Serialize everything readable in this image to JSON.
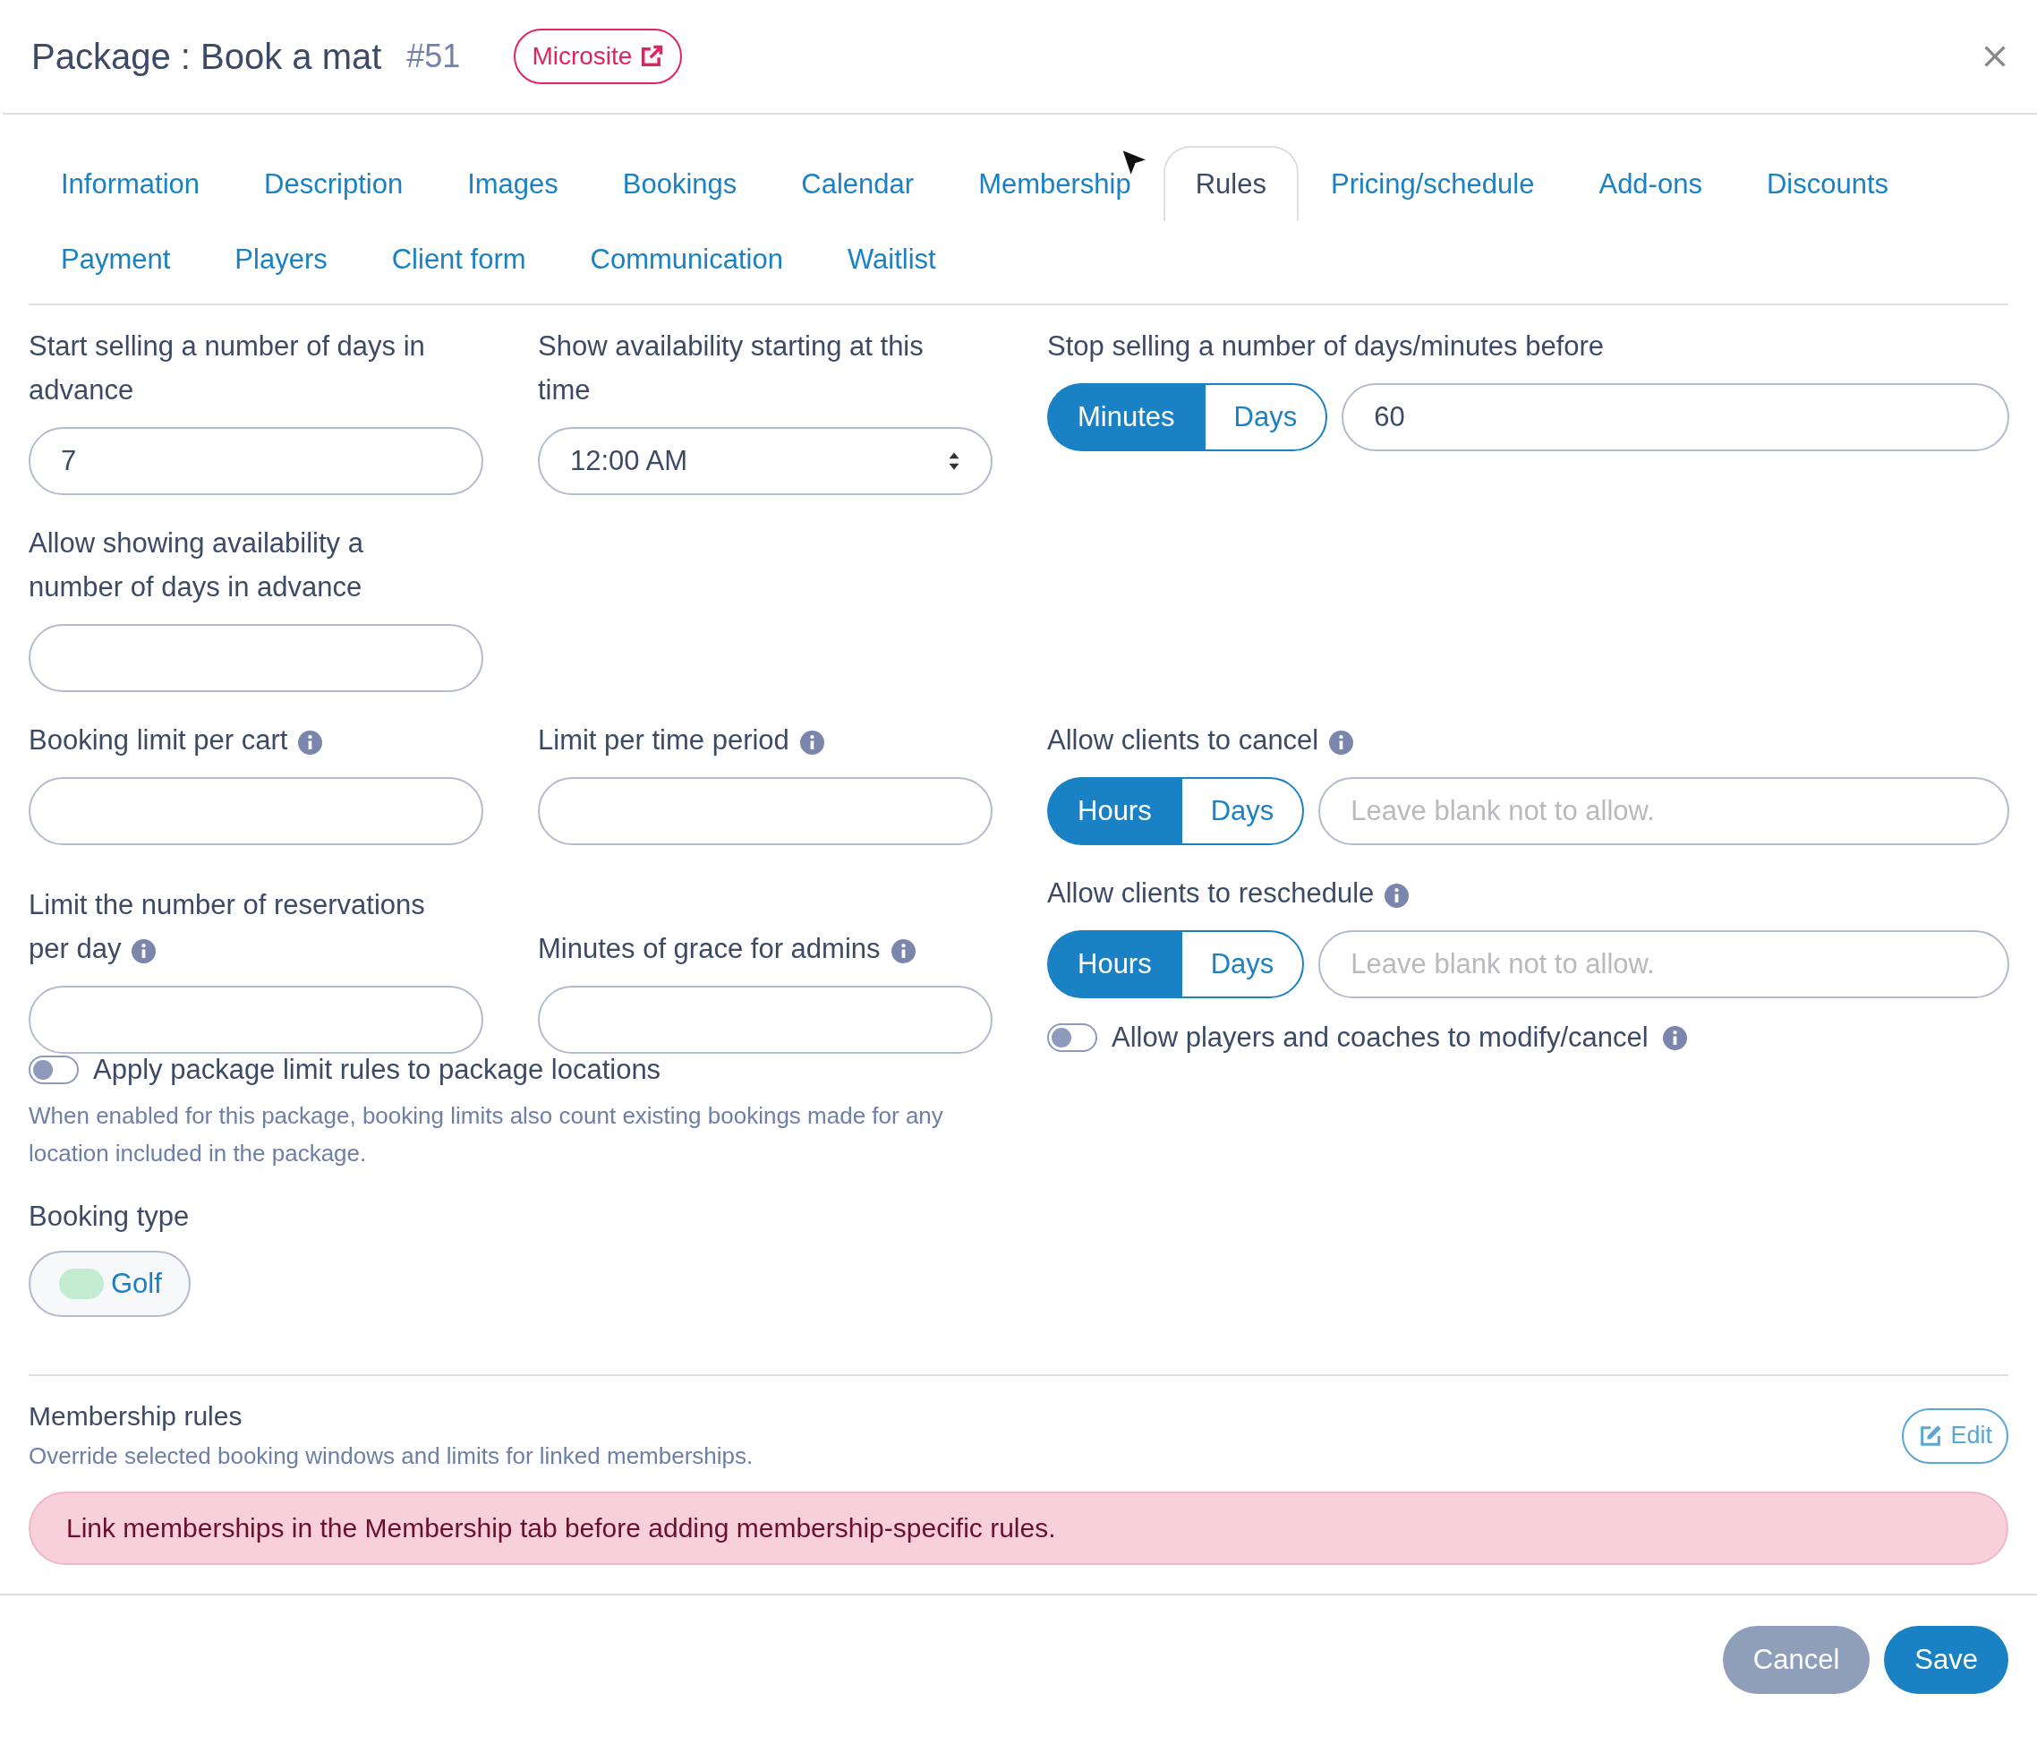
{
  "header": {
    "title": "Package : Book a mat",
    "number": "#51",
    "microsite_button": "Microsite"
  },
  "tabs": [
    {
      "label": "Information",
      "selected": false
    },
    {
      "label": "Description",
      "selected": false
    },
    {
      "label": "Images",
      "selected": false
    },
    {
      "label": "Bookings",
      "selected": false
    },
    {
      "label": "Calendar",
      "selected": false
    },
    {
      "label": "Membership",
      "selected": false
    },
    {
      "label": "Rules",
      "selected": true
    },
    {
      "label": "Pricing/schedule",
      "selected": false
    },
    {
      "label": "Add-ons",
      "selected": false
    },
    {
      "label": "Discounts",
      "selected": false
    },
    {
      "label": "Payment",
      "selected": false
    },
    {
      "label": "Players",
      "selected": false
    },
    {
      "label": "Client form",
      "selected": false
    },
    {
      "label": "Communication",
      "selected": false
    },
    {
      "label": "Waitlist",
      "selected": false
    }
  ],
  "rows": [
    [
      {
        "kind": "text",
        "label": "Start selling a number of days in advance",
        "value": "7",
        "info": false
      },
      {
        "kind": "select",
        "label": "Show availability starting at this time",
        "value": "12:00 AM",
        "info": false
      },
      {
        "kind": "unit_input",
        "label": "Stop selling a number of days/minutes before",
        "units": [
          {
            "label": "Minutes",
            "selected": true
          },
          {
            "label": "Days",
            "selected": false
          }
        ],
        "value": "60",
        "info": false
      }
    ],
    [
      {
        "kind": "text",
        "label": "Allow showing availability a number of days in advance",
        "info": false
      }
    ],
    [
      {
        "kind": "text",
        "label": "Booking limit per cart",
        "info": true
      },
      {
        "kind": "text",
        "label": "Limit per time period",
        "info": true
      },
      {
        "kind": "unit_input",
        "label": "Allow clients to cancel",
        "units": [
          {
            "label": "Hours",
            "selected": true
          },
          {
            "label": "Days",
            "selected": false
          }
        ],
        "placeholder": "Leave blank not to allow.",
        "info": true
      }
    ],
    [
      {
        "kind": "text",
        "label": "Limit the number of reservations per day",
        "info": true
      },
      {
        "kind": "text",
        "label": "Minutes of grace for admins",
        "info": true
      },
      {
        "kind": "unit_input",
        "label": "Allow clients to reschedule",
        "units": [
          {
            "label": "Hours",
            "selected": true
          },
          {
            "label": "Days",
            "selected": false
          }
        ],
        "placeholder": "Leave blank not to allow.",
        "info": true,
        "toggle": {
          "label": "Allow players and coaches to modify/cancel",
          "on": false,
          "info": true
        }
      }
    ]
  ],
  "package_limit_toggle": {
    "label": "Apply package limit rules to package locations",
    "on": false,
    "help": "When enabled for this package, booking limits also count existing bookings made for any location included in the package."
  },
  "booking_type": {
    "label": "Booking type",
    "options": [
      {
        "label": "Golf",
        "color": "#c3ebd0"
      }
    ]
  },
  "membership_rules": {
    "title": "Membership rules",
    "subtitle": "Override selected booking windows and limits for linked memberships.",
    "edit_button": "Edit",
    "alert": "Link memberships in the Membership tab before adding membership-specific rules."
  },
  "footer": {
    "buttons": [
      {
        "label": "Cancel",
        "kind": "secondary"
      },
      {
        "label": "Save",
        "kind": "primary"
      }
    ]
  }
}
